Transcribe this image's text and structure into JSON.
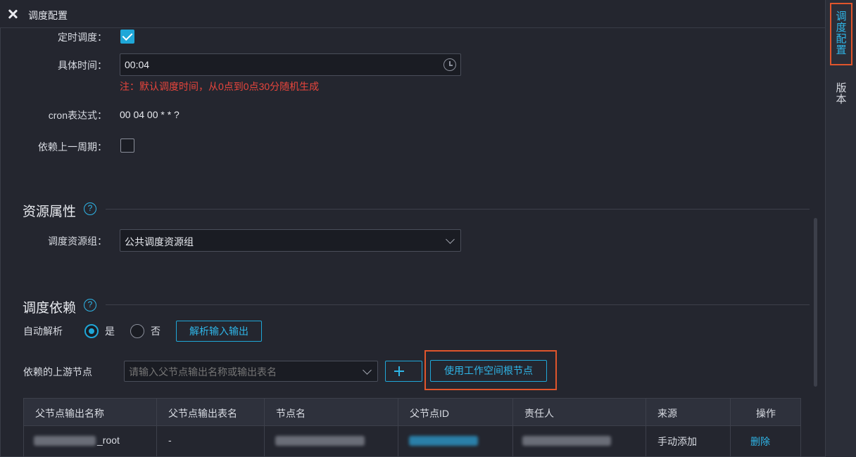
{
  "header": {
    "title": "调度配置"
  },
  "right_rail": {
    "active_tab": [
      "调",
      "度",
      "配",
      "置"
    ],
    "version_tab": [
      "版",
      "本"
    ]
  },
  "schedule": {
    "timed_label": "定时调度：",
    "timed_checked": true,
    "time_label": "具体时间：",
    "time_value": "00:04",
    "note": "注：默认调度时间，从0点到0点30分随机生成",
    "cron_label": "cron表达式：",
    "cron_value": "00 04 00 * * ?",
    "depend_prev_label": "依赖上一周期：",
    "depend_prev_checked": false
  },
  "resource": {
    "section_title": "资源属性",
    "group_label": "调度资源组：",
    "group_value": "公共调度资源组"
  },
  "dependency": {
    "section_title": "调度依赖",
    "auto_parse_label": "自动解析",
    "yes_label": "是",
    "no_label": "否",
    "auto_parse_selected": "是",
    "parse_button": "解析输入输出",
    "upstream_label": "依赖的上游节点",
    "upstream_placeholder": "请输入父节点输出名称或输出表名",
    "root_node_button": "使用工作空间根节点"
  },
  "table": {
    "headers": [
      "父节点输出名称",
      "父节点输出表名",
      "节点名",
      "父节点ID",
      "责任人",
      "来源",
      "操作"
    ],
    "rows": [
      {
        "output_name": "_root",
        "output_table": "-",
        "source": "手动添加",
        "action": "删除"
      }
    ]
  },
  "colors": {
    "accent": "#1fa7d8",
    "warning": "#e8453c",
    "highlight": "#e0552c",
    "background": "#24262f"
  }
}
